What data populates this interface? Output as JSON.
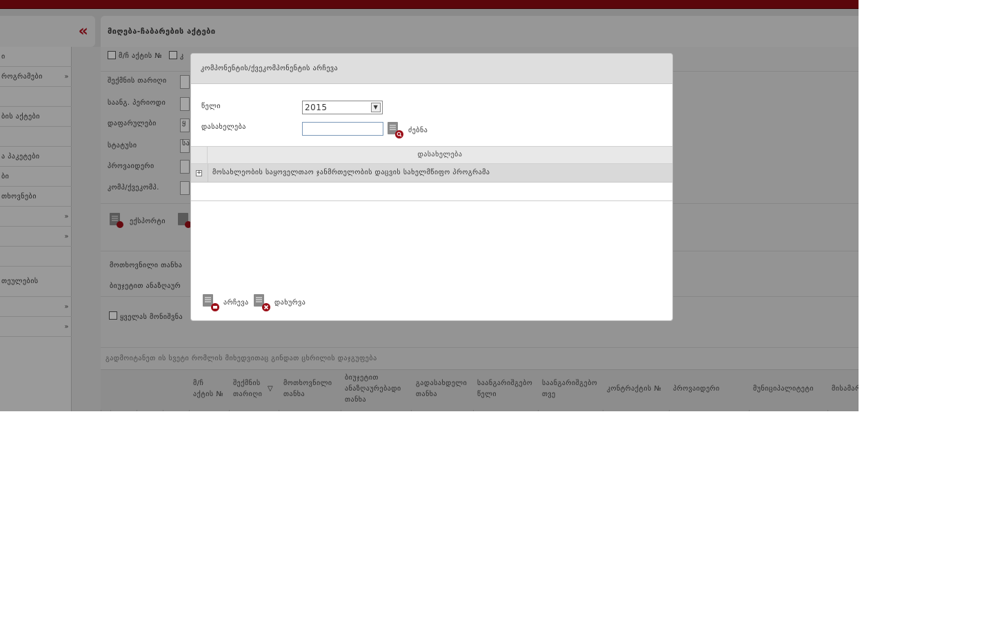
{
  "sidebar": {
    "items": [
      {
        "label": "ი",
        "chevron": false
      },
      {
        "label": "როგრამები",
        "chevron": true
      },
      {
        "label": "",
        "chevron": false
      },
      {
        "label": "ბის აქტები",
        "chevron": false
      },
      {
        "label": "",
        "chevron": false
      },
      {
        "label": "ა პაკეტები",
        "chevron": false
      },
      {
        "label": "ბი",
        "chevron": false
      },
      {
        "label": "თხოვნები",
        "chevron": false
      },
      {
        "label": "",
        "chevron": true
      },
      {
        "label": "",
        "chevron": true
      },
      {
        "label": "",
        "chevron": false
      },
      {
        "label": "თეულების",
        "chevron": false
      },
      {
        "label": "",
        "chevron": true
      },
      {
        "label": "",
        "chevron": true
      }
    ]
  },
  "main": {
    "title": "მიღება-ჩაბარების აქტები",
    "filters": {
      "act_number": "მ/ჩ აქტის №",
      "k_partial": "კ",
      "created_date": "შექმნის თარიღი",
      "billing_period": "საანგ. პერიოდი",
      "financed": "დაფარულები",
      "status": "სტატუსი",
      "provider": "პროვაიდერი",
      "component": "კომპ/ქვეკომპ.",
      "status_partial": "სა",
      "financed_partial": "ყ"
    },
    "export_label": "ექსპორტი",
    "requested_sum": "მოთხოვნილი თანხა",
    "budget_sum": "ბიუჯეტით ანაზღაურ",
    "select_all": "ყველას მონიშვნა",
    "group_hint": "გადმოიტანეთ ის სვეტი რომლის მიხედვითაც გინდათ ცხრილის დაჯგუფება",
    "columns": [
      "მ/ჩ\nაქტის №",
      "შექმნის\nთარიღი",
      "მოთხოვნილი\nთანხა",
      "ბიუჯეტით\nანაზღაურებადი\nთანხა",
      "გადასახდელი\nთანხა",
      "საანგარიშგებო\nწელი",
      "საანგარიშგებო\nთვე",
      "კონტრაქტის №",
      "პროვაიდერი",
      "მუნიციპალიტეტი",
      "მისამარ"
    ]
  },
  "modal": {
    "title": "კომპონენტის/ქვეკომპონენტის არჩევა",
    "year_label": "წელი",
    "year_value": "2015",
    "name_label": "დასახელება",
    "name_value": "",
    "search_label": "ძებნა",
    "grid": {
      "column": "დასახელება",
      "expander": "+",
      "rows": [
        "მოსახლეობის საყოველთაო ჯანმრთელობის დაცვის სახელმწიფო პროგრამა"
      ]
    },
    "select_label": "არჩევა",
    "close_label": "დახურვა"
  },
  "icons": {
    "collapse": "double-chevron-left-icon",
    "document": "document-icon",
    "search": "search-icon",
    "close": "close-icon",
    "expand": "plus-box-icon"
  },
  "colors": {
    "accent": "#8c0a12",
    "badge": "#b01220"
  }
}
